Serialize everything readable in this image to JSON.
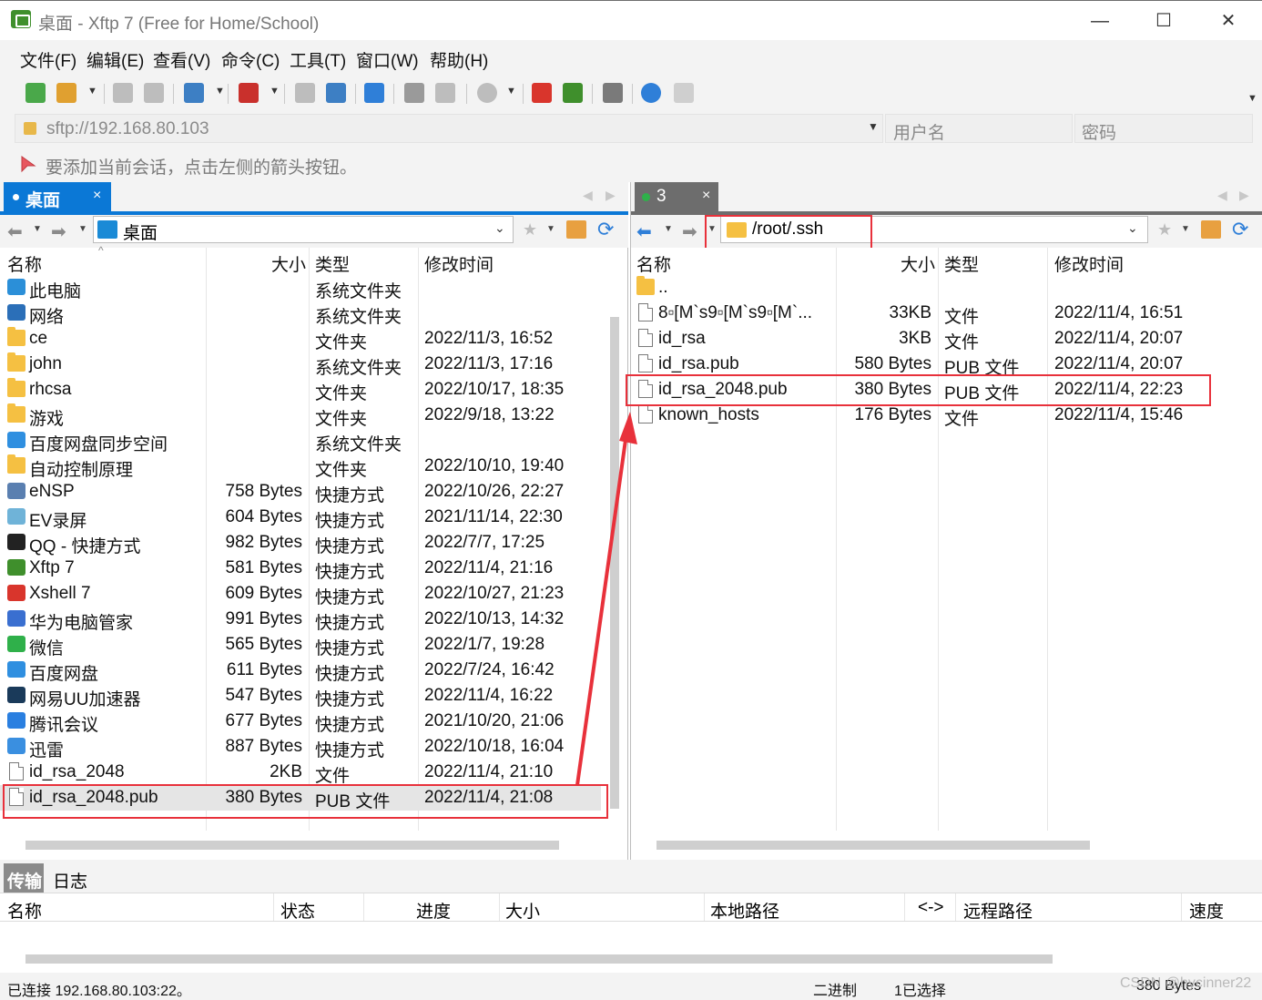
{
  "window": {
    "title": "桌面 - Xftp 7 (Free for Home/School)",
    "minimize": "—",
    "maximize": "☐",
    "close": "✕"
  },
  "menu": [
    "文件(F)",
    "编辑(E)",
    "查看(V)",
    "命令(C)",
    "工具(T)",
    "窗口(W)",
    "帮助(H)"
  ],
  "toolbar_icons": [
    {
      "name": "new-session-icon",
      "color": "#4aa84a"
    },
    {
      "name": "open-folder-icon",
      "color": "#e0a030"
    },
    {
      "name": "connect-icon",
      "color": "#bdbdbd"
    },
    {
      "name": "disconnect-icon",
      "color": "#bdbdbd"
    },
    {
      "name": "refresh-layout-icon",
      "color": "#3d7fc4"
    },
    {
      "name": "record-icon",
      "color": "#c9302c"
    },
    {
      "name": "copy-icon",
      "color": "#bdbdbd"
    },
    {
      "name": "paste-icon",
      "color": "#3d7fc4"
    },
    {
      "name": "sync-icon",
      "color": "#2f7fd8"
    },
    {
      "name": "clipboard-icon",
      "color": "#9a9a9a"
    },
    {
      "name": "clipboard2-icon",
      "color": "#bdbdbd"
    },
    {
      "name": "globe-icon",
      "color": "#bdbdbd"
    },
    {
      "name": "xshell-icon",
      "color": "#d9352c"
    },
    {
      "name": "xftp-icon",
      "color": "#3f8f2c"
    },
    {
      "name": "settings-icon",
      "color": "#7a7a7a"
    },
    {
      "name": "help-icon",
      "color": "#2f7fd8"
    },
    {
      "name": "message-icon",
      "color": "#cfcfcf"
    }
  ],
  "address": {
    "url": "sftp://192.168.80.103",
    "username_placeholder": "用户名",
    "password_placeholder": "密码"
  },
  "hint": "要添加当前会话，点击左侧的箭头按钮。",
  "left_panel": {
    "tab_label": "桌面",
    "tab_close": "×",
    "path": "桌面",
    "columns": [
      "名称",
      "大小",
      "类型",
      "修改时间"
    ],
    "rows": [
      {
        "name": "此电脑",
        "size": "",
        "type": "系统文件夹",
        "mtime": "",
        "icon": "pc",
        "color": "#2b8fd8"
      },
      {
        "name": "网络",
        "size": "",
        "type": "系统文件夹",
        "mtime": "",
        "icon": "net",
        "color": "#2b6fb8"
      },
      {
        "name": "ce",
        "size": "",
        "type": "文件夹",
        "mtime": "2022/11/3, 16:52",
        "icon": "folder"
      },
      {
        "name": "john",
        "size": "",
        "type": "系统文件夹",
        "mtime": "2022/11/3, 17:16",
        "icon": "folder"
      },
      {
        "name": "rhcsa",
        "size": "",
        "type": "文件夹",
        "mtime": "2022/10/17, 18:35",
        "icon": "folder"
      },
      {
        "name": "游戏",
        "size": "",
        "type": "文件夹",
        "mtime": "2022/9/18, 13:22",
        "icon": "folder"
      },
      {
        "name": "百度网盘同步空间",
        "size": "",
        "type": "系统文件夹",
        "mtime": "",
        "icon": "app",
        "color": "#2f8fe0"
      },
      {
        "name": "自动控制原理",
        "size": "",
        "type": "文件夹",
        "mtime": "2022/10/10, 19:40",
        "icon": "folder"
      },
      {
        "name": "eNSP",
        "size": "758 Bytes",
        "type": "快捷方式",
        "mtime": "2022/10/26, 22:27",
        "icon": "app",
        "color": "#5a7fb0"
      },
      {
        "name": "EV录屏",
        "size": "604 Bytes",
        "type": "快捷方式",
        "mtime": "2021/11/14, 22:30",
        "icon": "app",
        "color": "#6fb3d8"
      },
      {
        "name": "QQ - 快捷方式",
        "size": "982 Bytes",
        "type": "快捷方式",
        "mtime": "2022/7/7, 17:25",
        "icon": "app",
        "color": "#222222"
      },
      {
        "name": "Xftp 7",
        "size": "581 Bytes",
        "type": "快捷方式",
        "mtime": "2022/11/4, 21:16",
        "icon": "app",
        "color": "#3f8f2c"
      },
      {
        "name": "Xshell 7",
        "size": "609 Bytes",
        "type": "快捷方式",
        "mtime": "2022/10/27, 21:23",
        "icon": "app",
        "color": "#d9352c"
      },
      {
        "name": "华为电脑管家",
        "size": "991 Bytes",
        "type": "快捷方式",
        "mtime": "2022/10/13, 14:32",
        "icon": "app",
        "color": "#3a6fd0"
      },
      {
        "name": "微信",
        "size": "565 Bytes",
        "type": "快捷方式",
        "mtime": "2022/1/7, 19:28",
        "icon": "app",
        "color": "#2fb04a"
      },
      {
        "name": "百度网盘",
        "size": "611 Bytes",
        "type": "快捷方式",
        "mtime": "2022/7/24, 16:42",
        "icon": "app",
        "color": "#2f8fe0"
      },
      {
        "name": "网易UU加速器",
        "size": "547 Bytes",
        "type": "快捷方式",
        "mtime": "2022/11/4, 16:22",
        "icon": "app",
        "color": "#1a3a5a"
      },
      {
        "name": "腾讯会议",
        "size": "677 Bytes",
        "type": "快捷方式",
        "mtime": "2021/10/20, 21:06",
        "icon": "app",
        "color": "#2a7fe0"
      },
      {
        "name": "迅雷",
        "size": "887 Bytes",
        "type": "快捷方式",
        "mtime": "2022/10/18, 16:04",
        "icon": "app",
        "color": "#3a8fe0"
      },
      {
        "name": "id_rsa_2048",
        "size": "2KB",
        "type": "文件",
        "mtime": "2022/11/4, 21:10",
        "icon": "file"
      },
      {
        "name": "id_rsa_2048.pub",
        "size": "380 Bytes",
        "type": "PUB 文件",
        "mtime": "2022/11/4, 21:08",
        "icon": "file",
        "selected": true
      }
    ]
  },
  "right_panel": {
    "tab_label": "3",
    "tab_close": "×",
    "path": "/root/.ssh",
    "columns": [
      "名称",
      "大小",
      "类型",
      "修改时间"
    ],
    "rows": [
      {
        "name": "..",
        "size": "",
        "type": "",
        "mtime": "",
        "icon": "folder"
      },
      {
        "name": "8▫[M`s9▫[M`s9▫[M`...",
        "size": "33KB",
        "type": "文件",
        "mtime": "2022/11/4, 16:51",
        "icon": "file"
      },
      {
        "name": "id_rsa",
        "size": "3KB",
        "type": "文件",
        "mtime": "2022/11/4, 20:07",
        "icon": "file"
      },
      {
        "name": "id_rsa.pub",
        "size": "580 Bytes",
        "type": "PUB 文件",
        "mtime": "2022/11/4, 20:07",
        "icon": "file"
      },
      {
        "name": "id_rsa_2048.pub",
        "size": "380 Bytes",
        "type": "PUB 文件",
        "mtime": "2022/11/4, 22:23",
        "icon": "file"
      },
      {
        "name": "known_hosts",
        "size": "176 Bytes",
        "type": "文件",
        "mtime": "2022/11/4, 15:46",
        "icon": "file"
      }
    ]
  },
  "transfer": {
    "tabs": [
      "传输",
      "日志"
    ],
    "columns": [
      "名称",
      "状态",
      "进度",
      "大小",
      "本地路径",
      "<->",
      "远程路径",
      "速度"
    ]
  },
  "status": {
    "connection": "已连接 192.168.80.103:22。",
    "mode": "二进制",
    "selection": "1已选择",
    "size": "380 Bytes",
    "watermark": "CSDN @hycinner22"
  },
  "colors": {
    "tab_blue": "#0b78d6",
    "tab_gray": "#6d6d6d",
    "annotation_red": "#e8313b",
    "selected_row": "#e5e5e5",
    "connected_dot": "#2fb04a"
  }
}
